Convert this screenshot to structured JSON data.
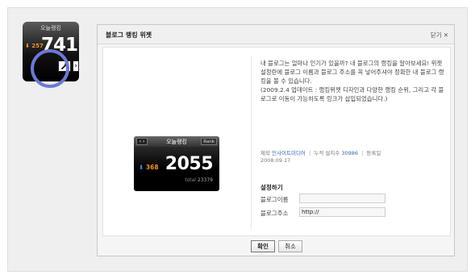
{
  "thumbnail": {
    "title": "오늘랭킹",
    "rank_value": "⬇ 257",
    "big_number": "741",
    "wrench_icon": "wrench-icon",
    "next_icon": "chevron-right-icon"
  },
  "dialog": {
    "title": "블로그 랭킹 위젯",
    "close_label": "닫기",
    "close_icon": "close-icon"
  },
  "preview": {
    "arrows": "‹ ›",
    "title": "오늘랭킹",
    "rank_button": "Rank",
    "rank_arrow": "⬇",
    "rank_value": "368",
    "big_number": "2055",
    "total_label": "total",
    "total_value": "23379"
  },
  "description": {
    "lines": [
      "내 블로그는 얼마나 인기가 있을까? 내 블로그의 랭킹을 알아보세요! 위젯 설정란에 블로그 이름과 블로그 주소를 꼭 넣어주셔야 정확한 내 블로그 랭킹을 볼 수 있습니다.",
      "(2009.2.4 업데이트 : 랭킹위젯 디자인과 다양한 랭킹 순위, 그리고 각 블로그로 이동이 가능하도록 링크가 삽입되었습니다.)"
    ]
  },
  "meta": {
    "maker_label": "제작",
    "maker_value": "인사이트미디어",
    "installs_label": "누적 설치수",
    "installs_value": "30986",
    "registered_label": "등록일",
    "registered_value": "2008.09.17"
  },
  "settings": {
    "title": "설정하기",
    "blog_name_label": "블로그이름",
    "blog_name_value": "",
    "blog_url_label": "블로그주소",
    "blog_url_value": "http://"
  },
  "buttons": {
    "ok": "확인",
    "cancel": "취소"
  },
  "colors": {
    "highlight_circle": "#6c78d8",
    "rank_orange": "#f7941d",
    "rank_arrow_blue": "#2a8fe6",
    "link_blue": "#3d64b8"
  }
}
